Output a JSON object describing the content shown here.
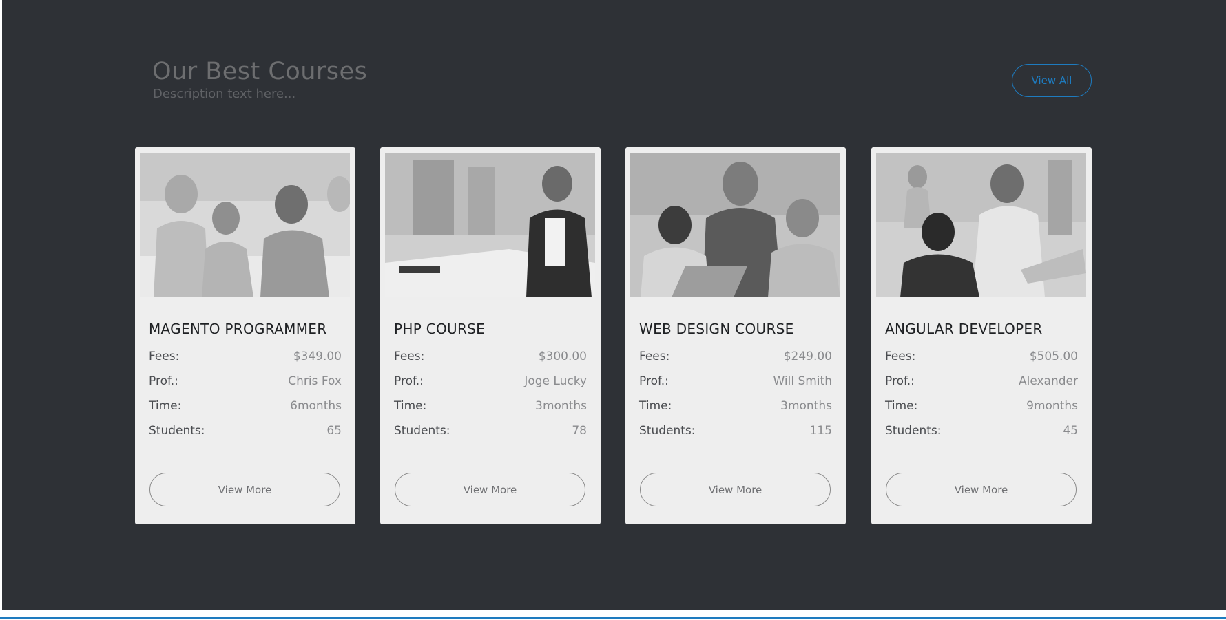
{
  "section": {
    "title": "Our Best Courses",
    "description": "Description text here...",
    "view_all_label": "View All"
  },
  "labels": {
    "fees": "Fees:",
    "prof": "Prof.:",
    "time": "Time:",
    "students": "Students:",
    "view_more": "View More"
  },
  "courses": [
    {
      "title": "MAGENTO PROGRAMMER",
      "fees": "$349.00",
      "prof": "Chris Fox",
      "time": "6months",
      "students": "65"
    },
    {
      "title": "PHP COURSE",
      "fees": "$300.00",
      "prof": "Joge Lucky",
      "time": "3months",
      "students": "78"
    },
    {
      "title": "WEB DESIGN COURSE",
      "fees": "$249.00",
      "prof": "Will Smith",
      "time": "3months",
      "students": "115"
    },
    {
      "title": "ANGULAR DEVELOPER",
      "fees": "$505.00",
      "prof": "Alexander",
      "time": "9months",
      "students": "45"
    }
  ],
  "colors": {
    "background": "#2e3136",
    "card": "#eeeeee",
    "accent": "#1e7bbf"
  }
}
